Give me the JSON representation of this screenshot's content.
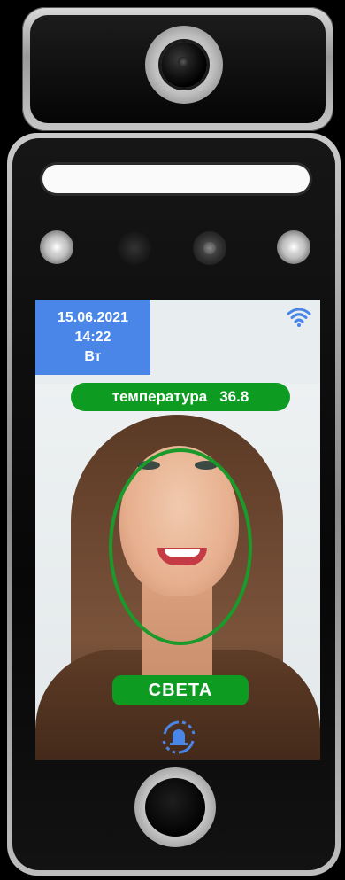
{
  "screen": {
    "date": "15.06.2021",
    "time": "14:22",
    "weekday": "Вт",
    "temperature_label": "температура",
    "temperature_value": "36.8",
    "person_name": "СВЕТА"
  },
  "icons": {
    "status": "wifi-icon",
    "bottom": "alarm-bell-icon"
  },
  "colors": {
    "info_box": "#4a86e8",
    "status_green": "#0e9b22",
    "face_frame": "#1a9a2a"
  }
}
